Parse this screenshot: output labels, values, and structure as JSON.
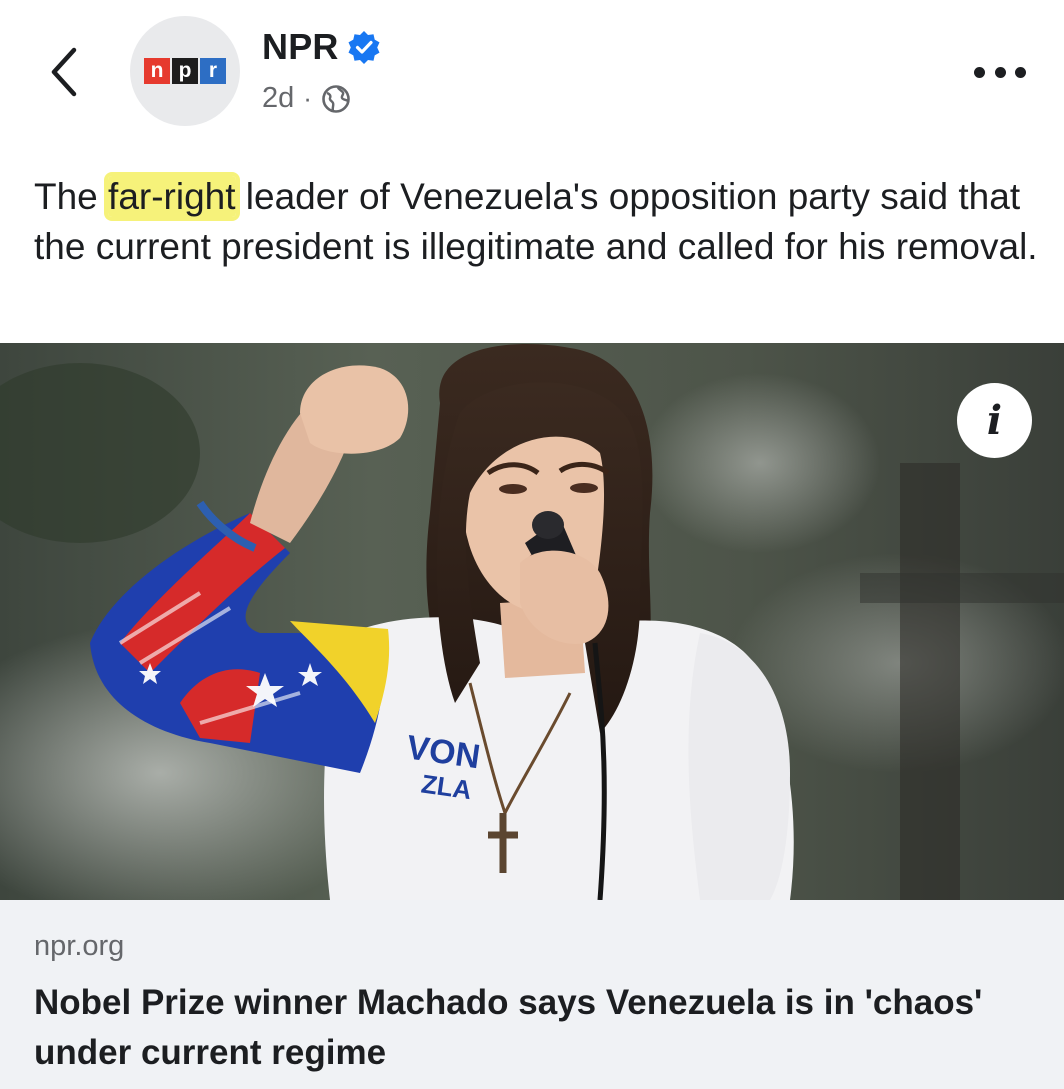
{
  "post": {
    "page_name": "NPR",
    "verified": true,
    "timestamp": "2d",
    "separator": "·",
    "audience_icon": "globe-icon",
    "avatar_letters": [
      "n",
      "p",
      "r"
    ],
    "text_before": "The ",
    "text_highlight": "far-right",
    "text_after": " leader of Venezuela's opposition party said that the current president is illegitimate and called for his removal.",
    "highlight_color": "#f6f27a"
  },
  "image": {
    "shirt_text_line1": "VON",
    "shirt_text_line2": "ZLA",
    "info_label": "i"
  },
  "link": {
    "domain": "npr.org",
    "title": "Nobel Prize winner Machado says Venezuela is in 'chaos' under current regime"
  },
  "colors": {
    "verified_blue": "#1877f2",
    "npr_red": "#e63a2e",
    "npr_black": "#1d1d1d",
    "npr_blue": "#2d6ec4",
    "preview_bg": "#f0f2f5",
    "secondary_text": "#65676b"
  },
  "icons": [
    "chevron-left-icon",
    "verified-icon",
    "globe-icon",
    "more-icon",
    "info-icon"
  ]
}
